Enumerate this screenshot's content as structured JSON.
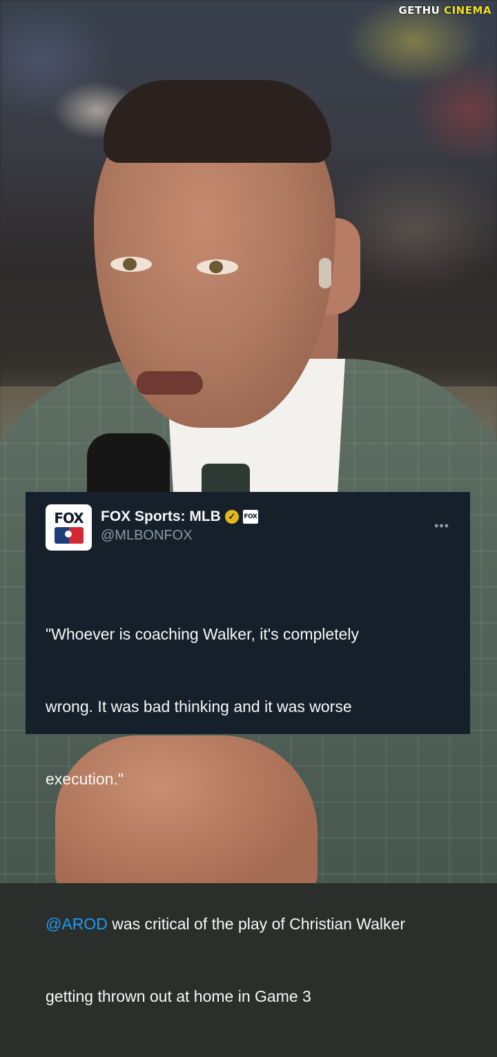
{
  "watermark": {
    "part1": "GETHU ",
    "part2": "CINEMA"
  },
  "tweet": {
    "display_name": "FOX Sports: MLB",
    "handle": "@MLBONFOX",
    "avatar_text": "FOX",
    "affiliate_badge_text": "FOX SPORTS",
    "verified_icon": "verified-gold-check-icon",
    "more_icon": "more-dots-icon",
    "more_label": "•••",
    "quote_lines": [
      "\"Whoever is coaching Walker, it's completely",
      "wrong. It was bad thinking and it was worse",
      "execution.\""
    ],
    "mention": "@AROD",
    "body_after_mention": " was critical of the play of Christian Walker",
    "body_line2": "getting thrown out at home in Game 3"
  },
  "colors": {
    "card_bg": "#15202b",
    "text": "#f7f9f9",
    "secondary": "#8b98a5",
    "link": "#1d9bf0",
    "verified": "#e2b719"
  }
}
